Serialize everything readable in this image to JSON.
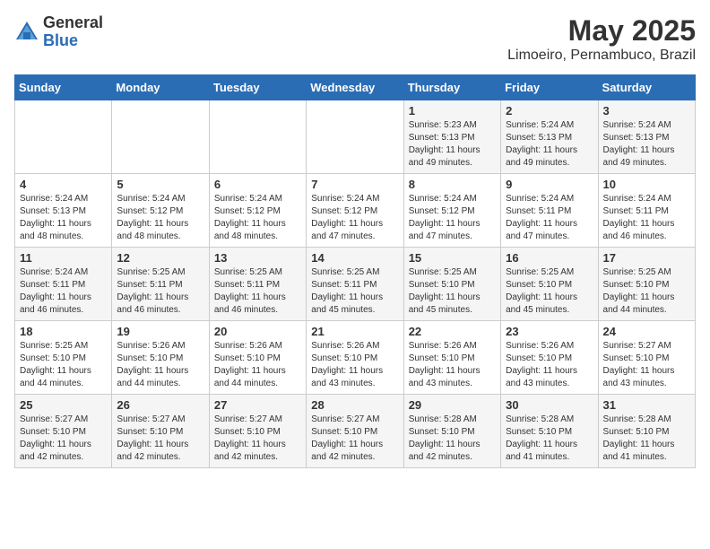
{
  "header": {
    "logo_line1": "General",
    "logo_line2": "Blue",
    "title": "May 2025",
    "subtitle": "Limoeiro, Pernambuco, Brazil"
  },
  "weekdays": [
    "Sunday",
    "Monday",
    "Tuesday",
    "Wednesday",
    "Thursday",
    "Friday",
    "Saturday"
  ],
  "weeks": [
    [
      {
        "day": "",
        "info": ""
      },
      {
        "day": "",
        "info": ""
      },
      {
        "day": "",
        "info": ""
      },
      {
        "day": "",
        "info": ""
      },
      {
        "day": "1",
        "info": "Sunrise: 5:23 AM\nSunset: 5:13 PM\nDaylight: 11 hours and 49 minutes."
      },
      {
        "day": "2",
        "info": "Sunrise: 5:24 AM\nSunset: 5:13 PM\nDaylight: 11 hours and 49 minutes."
      },
      {
        "day": "3",
        "info": "Sunrise: 5:24 AM\nSunset: 5:13 PM\nDaylight: 11 hours and 49 minutes."
      }
    ],
    [
      {
        "day": "4",
        "info": "Sunrise: 5:24 AM\nSunset: 5:13 PM\nDaylight: 11 hours and 48 minutes."
      },
      {
        "day": "5",
        "info": "Sunrise: 5:24 AM\nSunset: 5:12 PM\nDaylight: 11 hours and 48 minutes."
      },
      {
        "day": "6",
        "info": "Sunrise: 5:24 AM\nSunset: 5:12 PM\nDaylight: 11 hours and 48 minutes."
      },
      {
        "day": "7",
        "info": "Sunrise: 5:24 AM\nSunset: 5:12 PM\nDaylight: 11 hours and 47 minutes."
      },
      {
        "day": "8",
        "info": "Sunrise: 5:24 AM\nSunset: 5:12 PM\nDaylight: 11 hours and 47 minutes."
      },
      {
        "day": "9",
        "info": "Sunrise: 5:24 AM\nSunset: 5:11 PM\nDaylight: 11 hours and 47 minutes."
      },
      {
        "day": "10",
        "info": "Sunrise: 5:24 AM\nSunset: 5:11 PM\nDaylight: 11 hours and 46 minutes."
      }
    ],
    [
      {
        "day": "11",
        "info": "Sunrise: 5:24 AM\nSunset: 5:11 PM\nDaylight: 11 hours and 46 minutes."
      },
      {
        "day": "12",
        "info": "Sunrise: 5:25 AM\nSunset: 5:11 PM\nDaylight: 11 hours and 46 minutes."
      },
      {
        "day": "13",
        "info": "Sunrise: 5:25 AM\nSunset: 5:11 PM\nDaylight: 11 hours and 46 minutes."
      },
      {
        "day": "14",
        "info": "Sunrise: 5:25 AM\nSunset: 5:11 PM\nDaylight: 11 hours and 45 minutes."
      },
      {
        "day": "15",
        "info": "Sunrise: 5:25 AM\nSunset: 5:10 PM\nDaylight: 11 hours and 45 minutes."
      },
      {
        "day": "16",
        "info": "Sunrise: 5:25 AM\nSunset: 5:10 PM\nDaylight: 11 hours and 45 minutes."
      },
      {
        "day": "17",
        "info": "Sunrise: 5:25 AM\nSunset: 5:10 PM\nDaylight: 11 hours and 44 minutes."
      }
    ],
    [
      {
        "day": "18",
        "info": "Sunrise: 5:25 AM\nSunset: 5:10 PM\nDaylight: 11 hours and 44 minutes."
      },
      {
        "day": "19",
        "info": "Sunrise: 5:26 AM\nSunset: 5:10 PM\nDaylight: 11 hours and 44 minutes."
      },
      {
        "day": "20",
        "info": "Sunrise: 5:26 AM\nSunset: 5:10 PM\nDaylight: 11 hours and 44 minutes."
      },
      {
        "day": "21",
        "info": "Sunrise: 5:26 AM\nSunset: 5:10 PM\nDaylight: 11 hours and 43 minutes."
      },
      {
        "day": "22",
        "info": "Sunrise: 5:26 AM\nSunset: 5:10 PM\nDaylight: 11 hours and 43 minutes."
      },
      {
        "day": "23",
        "info": "Sunrise: 5:26 AM\nSunset: 5:10 PM\nDaylight: 11 hours and 43 minutes."
      },
      {
        "day": "24",
        "info": "Sunrise: 5:27 AM\nSunset: 5:10 PM\nDaylight: 11 hours and 43 minutes."
      }
    ],
    [
      {
        "day": "25",
        "info": "Sunrise: 5:27 AM\nSunset: 5:10 PM\nDaylight: 11 hours and 42 minutes."
      },
      {
        "day": "26",
        "info": "Sunrise: 5:27 AM\nSunset: 5:10 PM\nDaylight: 11 hours and 42 minutes."
      },
      {
        "day": "27",
        "info": "Sunrise: 5:27 AM\nSunset: 5:10 PM\nDaylight: 11 hours and 42 minutes."
      },
      {
        "day": "28",
        "info": "Sunrise: 5:27 AM\nSunset: 5:10 PM\nDaylight: 11 hours and 42 minutes."
      },
      {
        "day": "29",
        "info": "Sunrise: 5:28 AM\nSunset: 5:10 PM\nDaylight: 11 hours and 42 minutes."
      },
      {
        "day": "30",
        "info": "Sunrise: 5:28 AM\nSunset: 5:10 PM\nDaylight: 11 hours and 41 minutes."
      },
      {
        "day": "31",
        "info": "Sunrise: 5:28 AM\nSunset: 5:10 PM\nDaylight: 11 hours and 41 minutes."
      }
    ]
  ]
}
